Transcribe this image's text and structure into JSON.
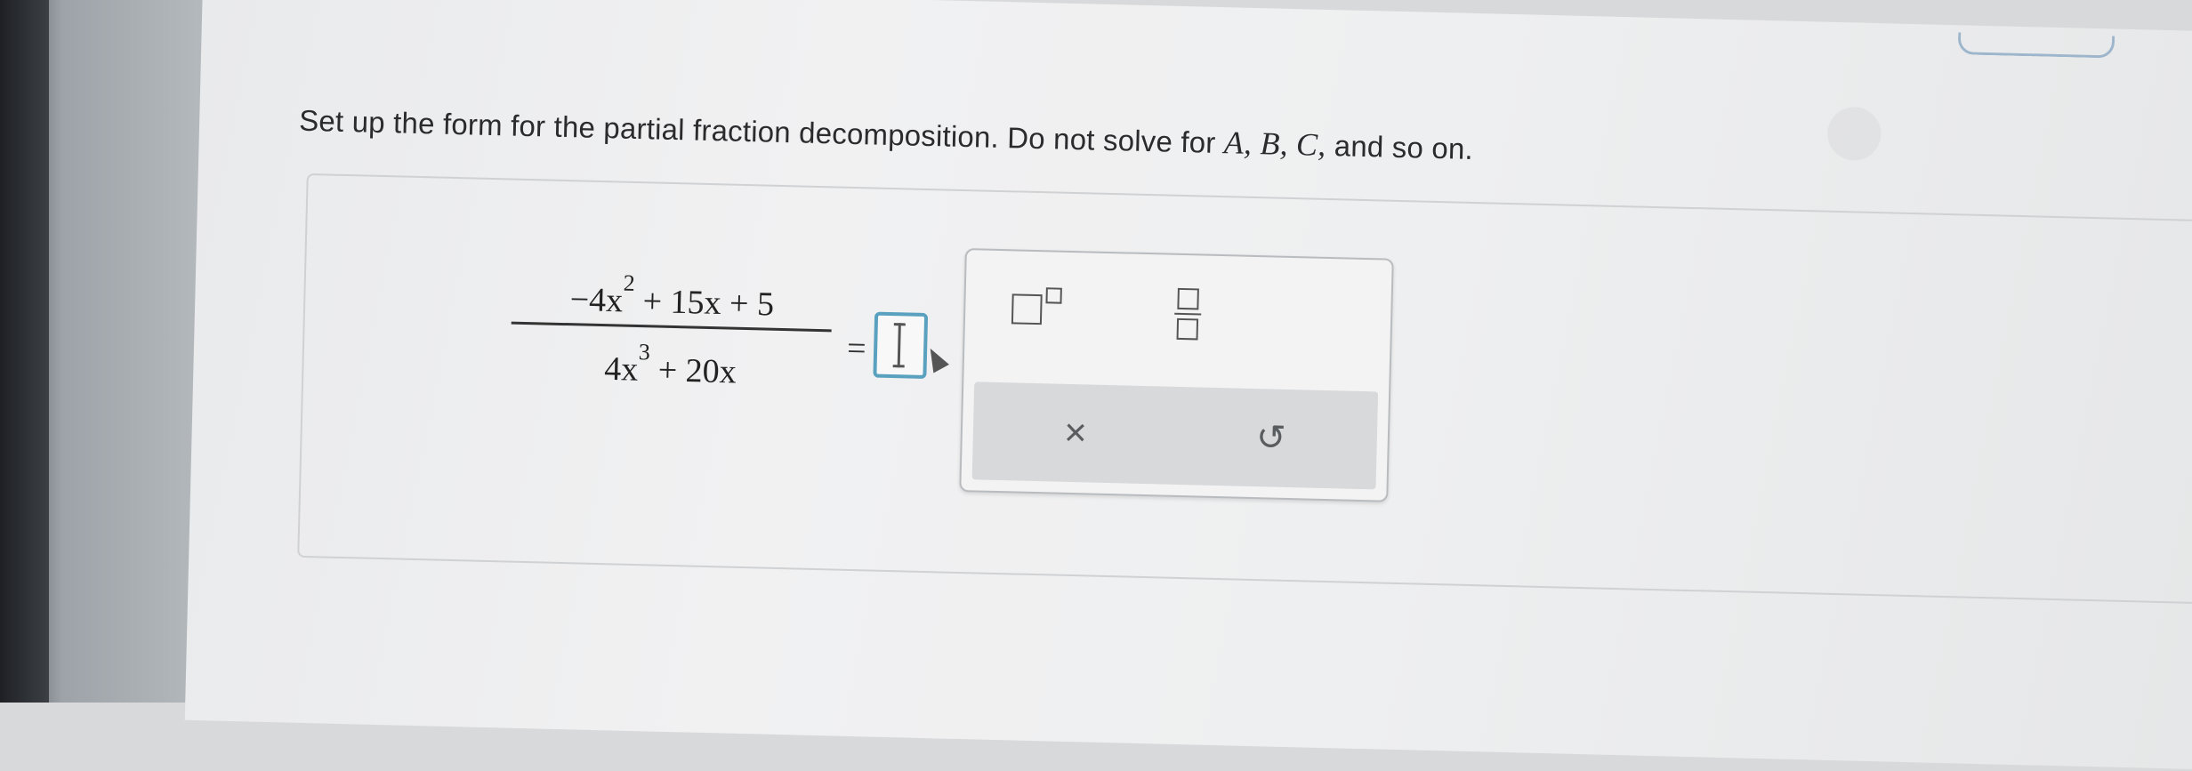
{
  "question": {
    "text": "Set up the form for the partial fraction decomposition. Do not solve for",
    "vars": "A, B, C,",
    "suffix": "and so on."
  },
  "expression": {
    "numerator_a": "−4x",
    "numerator_a_exp": "2",
    "numerator_b": "+ 15x + 5",
    "denominator_a": "4x",
    "denominator_a_exp": "3",
    "denominator_b": "+ 20x",
    "equals": "="
  },
  "palette": {
    "clear_symbol": "×",
    "undo_symbol": "↺"
  },
  "icons": [
    "exponent-template-icon",
    "fraction-template-icon",
    "close-icon",
    "undo-icon",
    "text-cursor-icon",
    "mouse-pointer-icon"
  ],
  "colors": {
    "answer_box_border": "#5aa0bf",
    "action_bar": "#d7d9db"
  }
}
